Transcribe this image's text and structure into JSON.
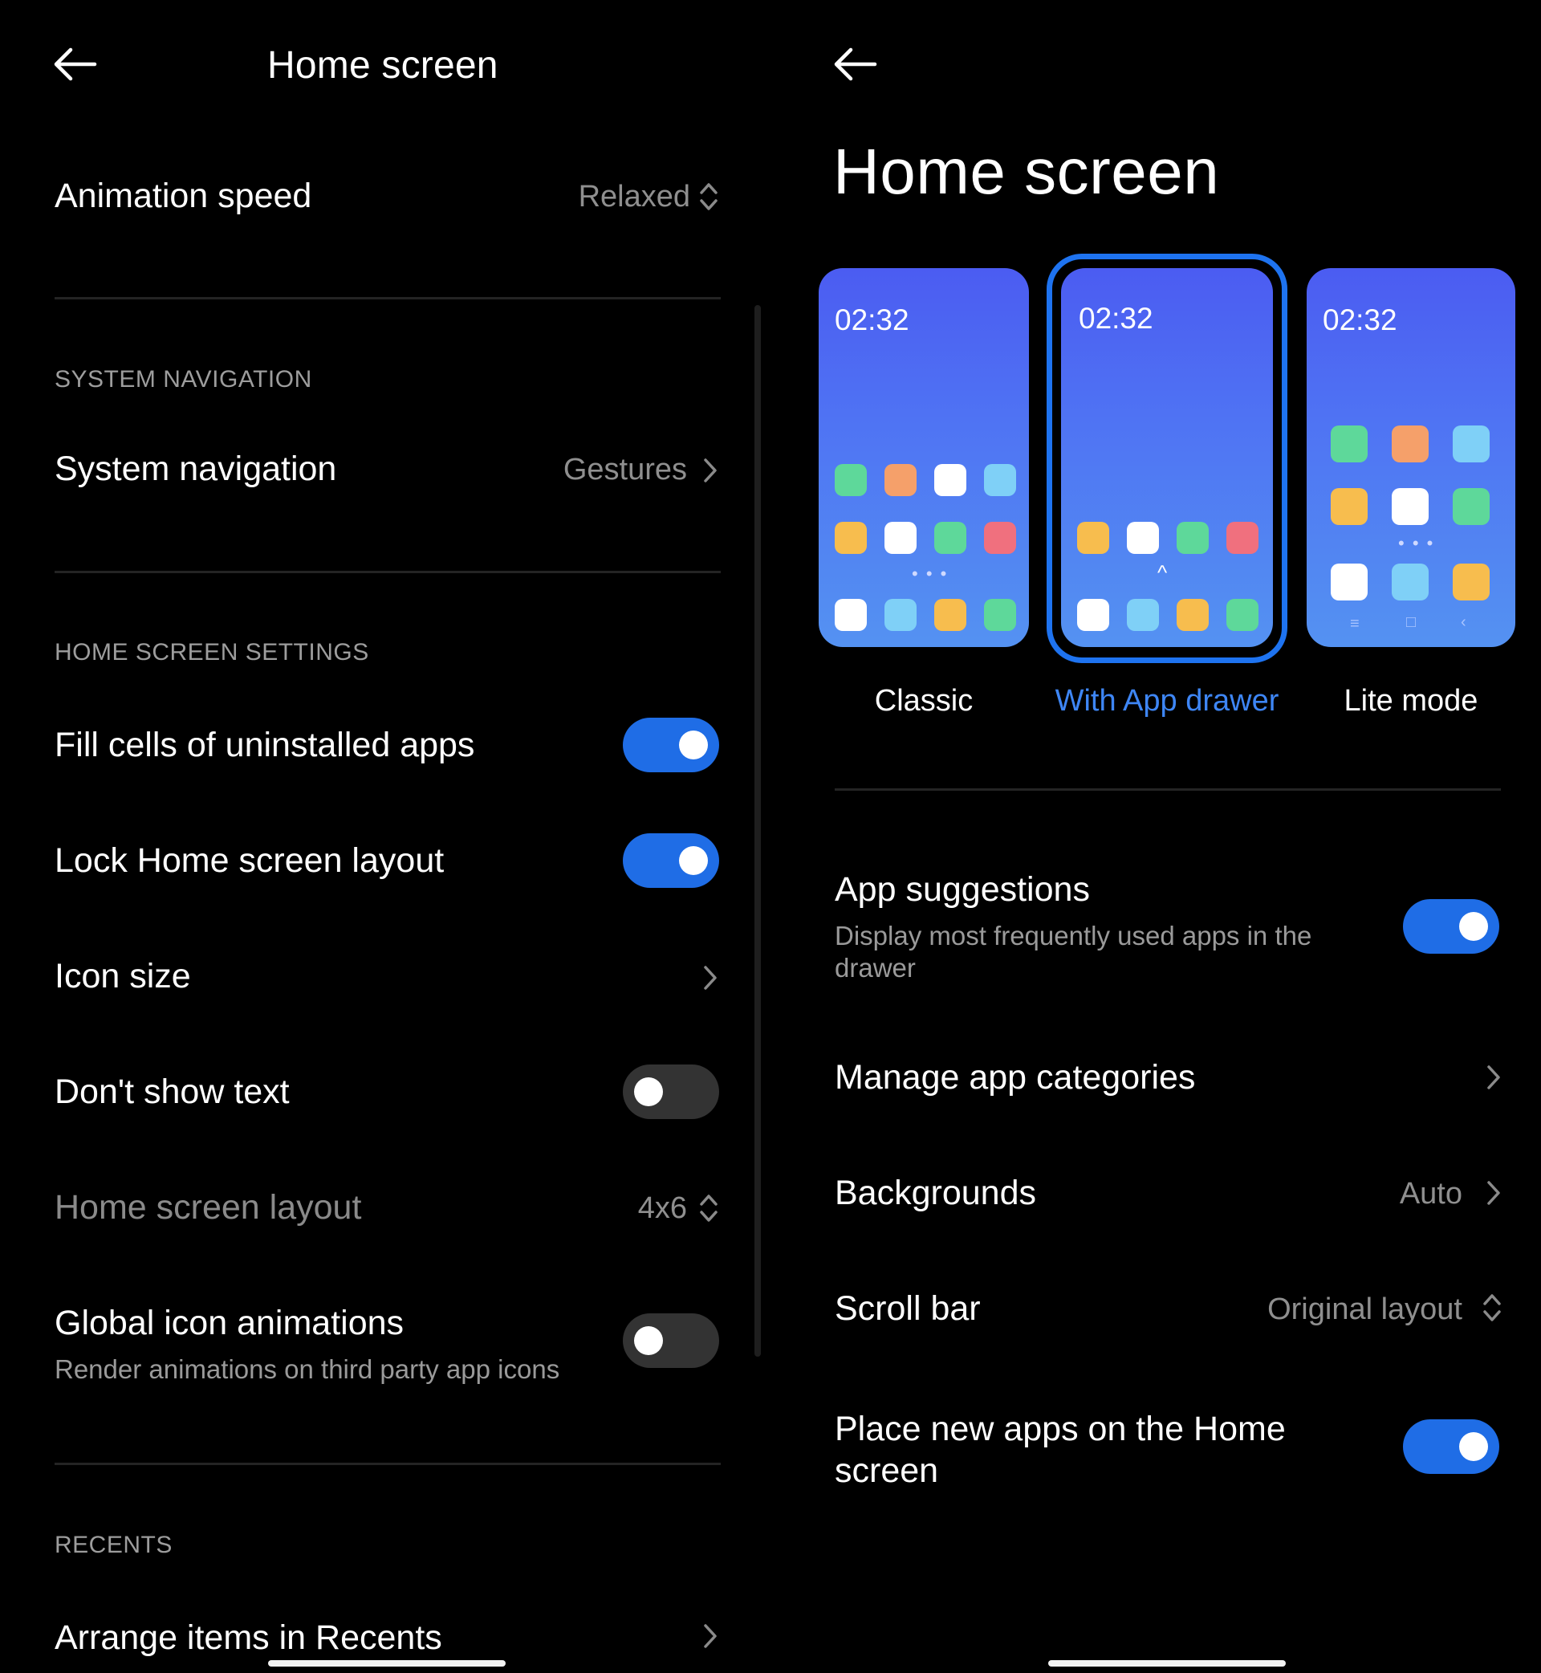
{
  "left": {
    "header_title": "Home screen",
    "animation_speed": {
      "label": "Animation speed",
      "value": "Relaxed"
    },
    "section_system_navigation": "SYSTEM NAVIGATION",
    "system_navigation": {
      "label": "System navigation",
      "value": "Gestures"
    },
    "section_home_screen_settings": "HOME SCREEN SETTINGS",
    "fill_cells": {
      "label": "Fill cells of uninstalled apps",
      "enabled": true
    },
    "lock_layout": {
      "label": "Lock Home screen layout",
      "enabled": true
    },
    "icon_size": {
      "label": "Icon size"
    },
    "dont_show_text": {
      "label": "Don't show text",
      "enabled": false
    },
    "home_screen_layout": {
      "label": "Home screen layout",
      "value": "4x6"
    },
    "global_icon_animations": {
      "label": "Global icon animations",
      "subtitle": "Render animations on third party app icons",
      "enabled": false
    },
    "section_recents": "RECENTS",
    "arrange_recents": {
      "label": "Arrange items in Recents"
    }
  },
  "right": {
    "header_title": "Home screen",
    "layouts": [
      {
        "label": "Classic",
        "time": "02:32",
        "selected": false
      },
      {
        "label": "With App drawer",
        "time": "02:32",
        "selected": true
      },
      {
        "label": "Lite mode",
        "time": "02:32",
        "selected": false
      }
    ],
    "app_suggestions": {
      "label": "App suggestions",
      "subtitle": "Display most frequently used apps in the drawer",
      "enabled": true
    },
    "manage_categories": {
      "label": "Manage app categories"
    },
    "backgrounds": {
      "label": "Backgrounds",
      "value": "Auto"
    },
    "scroll_bar": {
      "label": "Scroll bar",
      "value": "Original layout"
    },
    "place_new_apps": {
      "label": "Place new apps on the Home screen",
      "enabled": true
    }
  },
  "colors": {
    "accent": "#1f6de6",
    "selected_text": "#3e86f5",
    "background": "#000000",
    "app_green": "#5ed89a",
    "app_orange": "#f5a06a",
    "app_white": "#ffffff",
    "app_cyan": "#7fd0f7",
    "app_yellow": "#f7bd4e",
    "app_pink": "#f0707e"
  },
  "icons": [
    "back-arrow-icon",
    "chevron-right-icon",
    "updown-chevron-icon"
  ]
}
